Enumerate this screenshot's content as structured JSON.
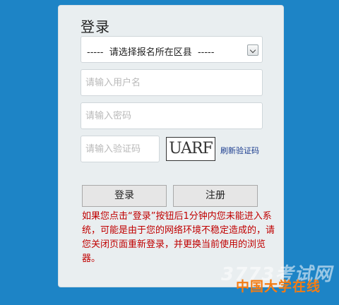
{
  "login": {
    "title": "登录",
    "region_select": "-----  请选择报名所在区县  -----",
    "username_placeholder": "请输入用户名",
    "password_placeholder": "请输入密码",
    "captcha_placeholder": "请输入验证码",
    "captcha_code": "UARF",
    "refresh_label": "刷新验证码",
    "login_button": "登录",
    "register_button": "注册",
    "notice": "如果您点击“登录”按钮后1分钟内您未能进入系统，可能是由于您的网络环境不稳定造成的，请您关闭页面重新登录，并更换当前使用的浏览器。"
  },
  "watermark": {
    "site_number": "3773考试网",
    "site_name": "中国大学在线"
  },
  "colors": {
    "background": "#1d84c6",
    "panel": "#e9eef0",
    "notice": "#c00000",
    "link": "#1c3d8f",
    "watermark_accent": "#f57c12"
  }
}
